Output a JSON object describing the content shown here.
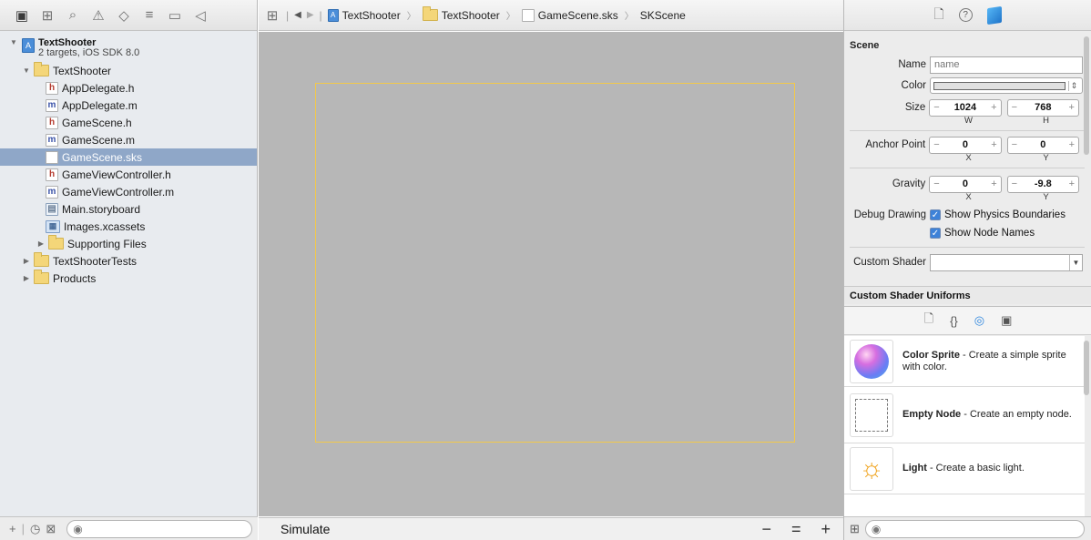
{
  "navigator": {
    "toolbar_icons": [
      {
        "name": "project-navigator-icon",
        "glyph": "▣"
      },
      {
        "name": "symbol-navigator-icon",
        "glyph": "⊞"
      },
      {
        "name": "find-navigator-icon",
        "glyph": "⌕"
      },
      {
        "name": "issue-navigator-icon",
        "glyph": "⚠"
      },
      {
        "name": "test-navigator-icon",
        "glyph": "◇"
      },
      {
        "name": "debug-navigator-icon",
        "glyph": "≡"
      },
      {
        "name": "breakpoint-navigator-icon",
        "glyph": "▭"
      },
      {
        "name": "report-navigator-icon",
        "glyph": "◁"
      }
    ],
    "project": {
      "name": "TextShooter",
      "subtitle": "2 targets, iOS SDK 8.0"
    },
    "items": [
      {
        "label": "TextShooter",
        "type": "folder",
        "level": 1,
        "expanded": true
      },
      {
        "label": "AppDelegate.h",
        "type": "h",
        "level": 2
      },
      {
        "label": "AppDelegate.m",
        "type": "m",
        "level": 2
      },
      {
        "label": "GameScene.h",
        "type": "h",
        "level": 2
      },
      {
        "label": "GameScene.m",
        "type": "m",
        "level": 2
      },
      {
        "label": "GameScene.sks",
        "type": "doc",
        "level": 2,
        "selected": true
      },
      {
        "label": "GameViewController.h",
        "type": "h",
        "level": 2
      },
      {
        "label": "GameViewController.m",
        "type": "m",
        "level": 2
      },
      {
        "label": "Main.storyboard",
        "type": "storyboard",
        "level": 2
      },
      {
        "label": "Images.xcassets",
        "type": "assets",
        "level": 2
      },
      {
        "label": "Supporting Files",
        "type": "folder",
        "level": 2,
        "expanded": false
      },
      {
        "label": "TextShooterTests",
        "type": "folder",
        "level": 1,
        "expanded": false
      },
      {
        "label": "Products",
        "type": "folder",
        "level": 1,
        "expanded": false
      }
    ],
    "footer": {
      "add_icon": "+",
      "recent_icon": "◷",
      "scm_icon": "⊠",
      "filter_icon": "◉"
    }
  },
  "jumpbar": {
    "grid_icon": "⊞",
    "back_icon": "◀",
    "forward_icon": "▶",
    "crumbs": [
      "TextShooter",
      "TextShooter",
      "GameScene.sks",
      "SKScene"
    ]
  },
  "editor": {
    "footer_label": "Simulate",
    "zoom_out": "−",
    "zoom_reset": "=",
    "zoom_in": "+"
  },
  "inspector": {
    "tabs": [
      {
        "name": "file-inspector-icon",
        "glyph": "🗋"
      },
      {
        "name": "quick-help-icon",
        "glyph": "?"
      }
    ],
    "section_title": "Scene",
    "name_label": "Name",
    "name_placeholder": "name",
    "color_label": "Color",
    "size_label": "Size",
    "size_w": "1024",
    "size_h": "768",
    "w_label": "W",
    "h_label": "H",
    "anchor_label": "Anchor Point",
    "anchor_x": "0",
    "anchor_y": "0",
    "x_label": "X",
    "y_label": "Y",
    "gravity_label": "Gravity",
    "gravity_x": "0",
    "gravity_y": "-9.8",
    "debug_label": "Debug Drawing",
    "show_physics": "Show Physics Boundaries",
    "show_names": "Show Node Names",
    "shader_label": "Custom Shader",
    "shader_uniforms": "Custom Shader Uniforms",
    "minus": "−",
    "plus": "+"
  },
  "library": {
    "tabs": [
      {
        "name": "file-template-library-icon",
        "glyph": "🗋"
      },
      {
        "name": "code-snippet-library-icon",
        "glyph": "{}"
      },
      {
        "name": "object-library-icon",
        "glyph": "◎",
        "active": true
      },
      {
        "name": "media-library-icon",
        "glyph": "▣"
      }
    ],
    "items": [
      {
        "title": "Color Sprite",
        "desc": " - Create a simple sprite with color.",
        "thumb": "color-sprite"
      },
      {
        "title": "Empty Node",
        "desc": " - Create an empty node.",
        "thumb": "empty-node"
      },
      {
        "title": "Light",
        "desc": " - Create a basic light.",
        "thumb": "light"
      }
    ],
    "footer": {
      "grid_icon": "⊞",
      "filter_icon": "◉"
    }
  }
}
